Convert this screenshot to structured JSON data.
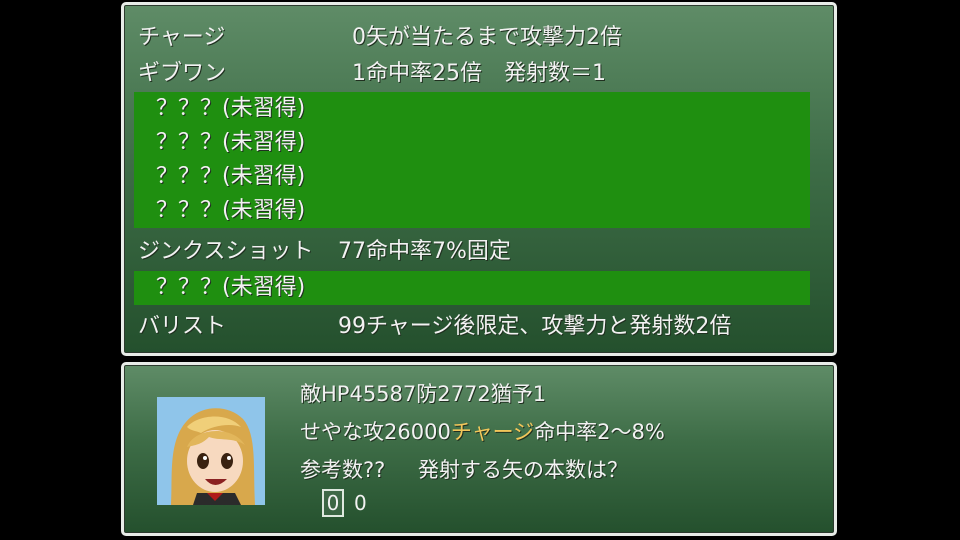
{
  "skill_list": {
    "rows": [
      {
        "name": "チャージ",
        "desc": "0矢が当たるまで攻撃力2倍",
        "highlight": false,
        "locked": false
      },
      {
        "name": "ギブワン",
        "desc": "1命中率25倍　発射数＝1",
        "highlight": false,
        "locked": false
      },
      {
        "name": "？？？(未習得)",
        "desc": "",
        "highlight": true,
        "locked": true
      },
      {
        "name": "？？？(未習得)",
        "desc": "",
        "highlight": true,
        "locked": true
      },
      {
        "name": "？？？(未習得)",
        "desc": "",
        "highlight": true,
        "locked": true
      },
      {
        "name": "？？？(未習得)",
        "desc": "",
        "highlight": true,
        "locked": true
      },
      {
        "name": "ジンクスショット",
        "desc": "77命中率7%固定",
        "highlight": false,
        "locked": false
      },
      {
        "name": "？？？(未習得)",
        "desc": "",
        "highlight": true,
        "locked": true
      },
      {
        "name": "バリスト",
        "desc": "99チャージ後限定、攻撃力と発射数2倍",
        "highlight": false,
        "locked": false
      }
    ]
  },
  "info": {
    "line1": "敵HP45587防2772猶予1",
    "line2_prefix": "せやな攻26000",
    "line2_accent": "チャージ",
    "line2_suffix": "命中率2～8%",
    "line3_left": "参考数??",
    "line3_question": "発射する矢の本数は？",
    "digit_selected": "0",
    "digit_next": "0",
    "accent_color": "#f2c65a",
    "highlight_color": "#1f8f10"
  }
}
